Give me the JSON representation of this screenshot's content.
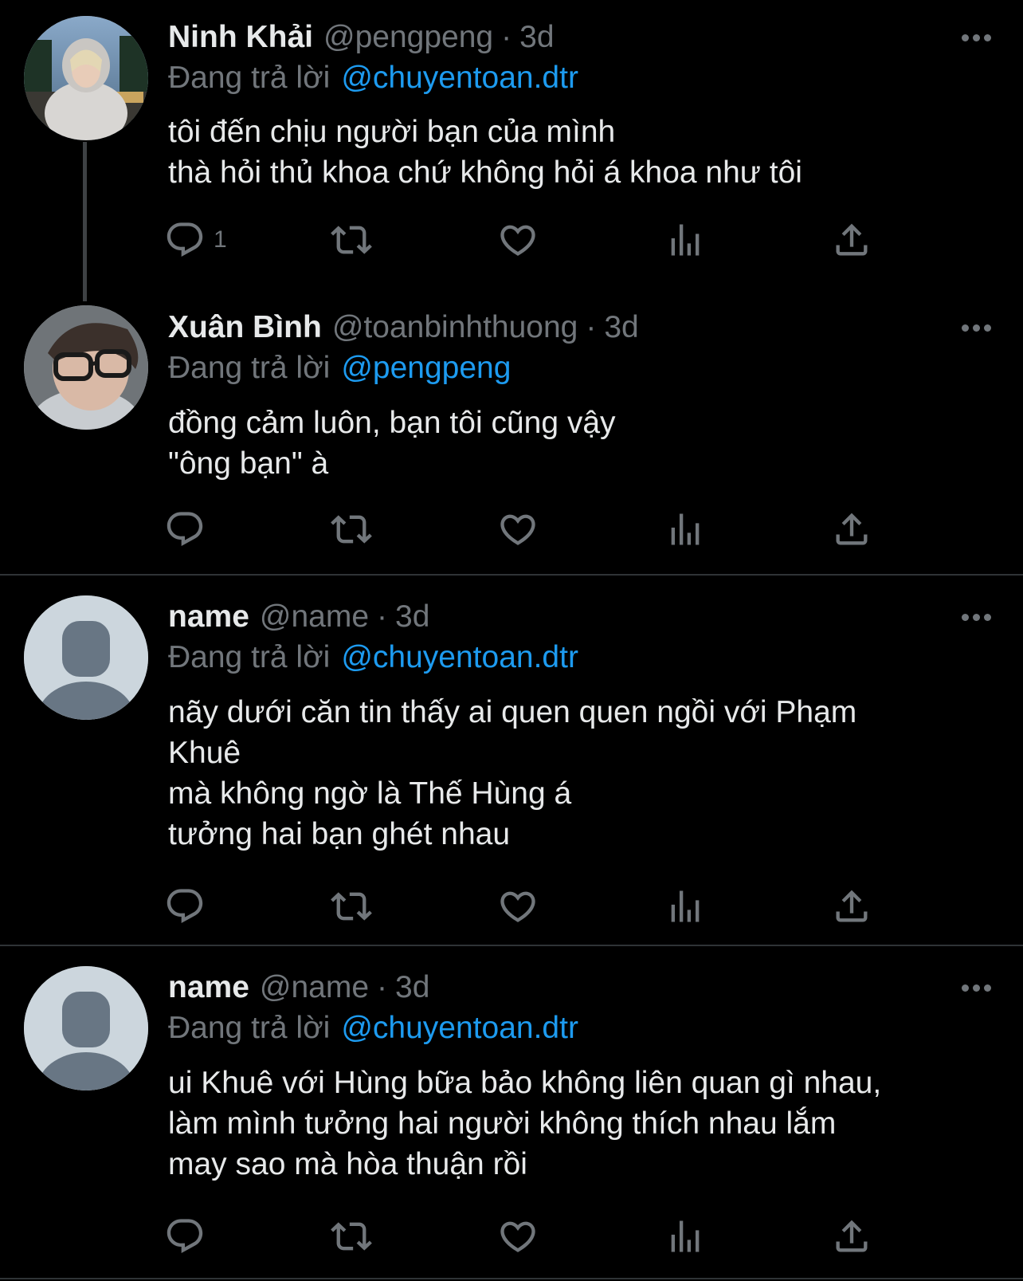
{
  "tweets": [
    {
      "name": "Ninh Khải",
      "handle": "@pengpeng",
      "time": "3d",
      "replying_label": "Đang trả lời",
      "replying_to": "@chuyentoan.dtr",
      "text": "tôi đến chịu người bạn của mình\nthà hỏi thủ khoa chứ không hỏi á khoa như tôi",
      "reply_count": "1",
      "avatar": "photo"
    },
    {
      "name": "Xuân Bình",
      "handle": "@toanbinhthuong",
      "time": "3d",
      "replying_label": "Đang trả lời",
      "replying_to": "@pengpeng",
      "text": "đồng cảm luôn, bạn tôi cũng vậy\n\"ông bạn\" à",
      "reply_count": "",
      "avatar": "photo"
    },
    {
      "name": "name",
      "handle": "@name",
      "time": "3d",
      "replying_label": "Đang trả lời",
      "replying_to": "@chuyentoan.dtr",
      "text": "nãy dưới căn tin thấy ai quen quen ngồi với Phạm\nKhuê\nmà không ngờ là Thế Hùng á\ntưởng hai bạn ghét nhau",
      "reply_count": "",
      "avatar": "default"
    },
    {
      "name": "name",
      "handle": "@name",
      "time": "3d",
      "replying_label": "Đang trả lời",
      "replying_to": "@chuyentoan.dtr",
      "text": "ui Khuê với Hùng bữa bảo không liên quan gì nhau,\nlàm mình tưởng hai người không thích nhau lắm\nmay sao mà hòa thuận rồi",
      "reply_count": "",
      "avatar": "default"
    }
  ],
  "separator": "·",
  "icons": [
    "reply-icon",
    "retweet-icon",
    "like-icon",
    "views-icon",
    "share-icon",
    "more-icon"
  ],
  "colors": {
    "background": "#000000",
    "text": "#e7e9ea",
    "secondary": "#71767b",
    "link": "#1d9bf0",
    "divider": "#2f3336"
  }
}
